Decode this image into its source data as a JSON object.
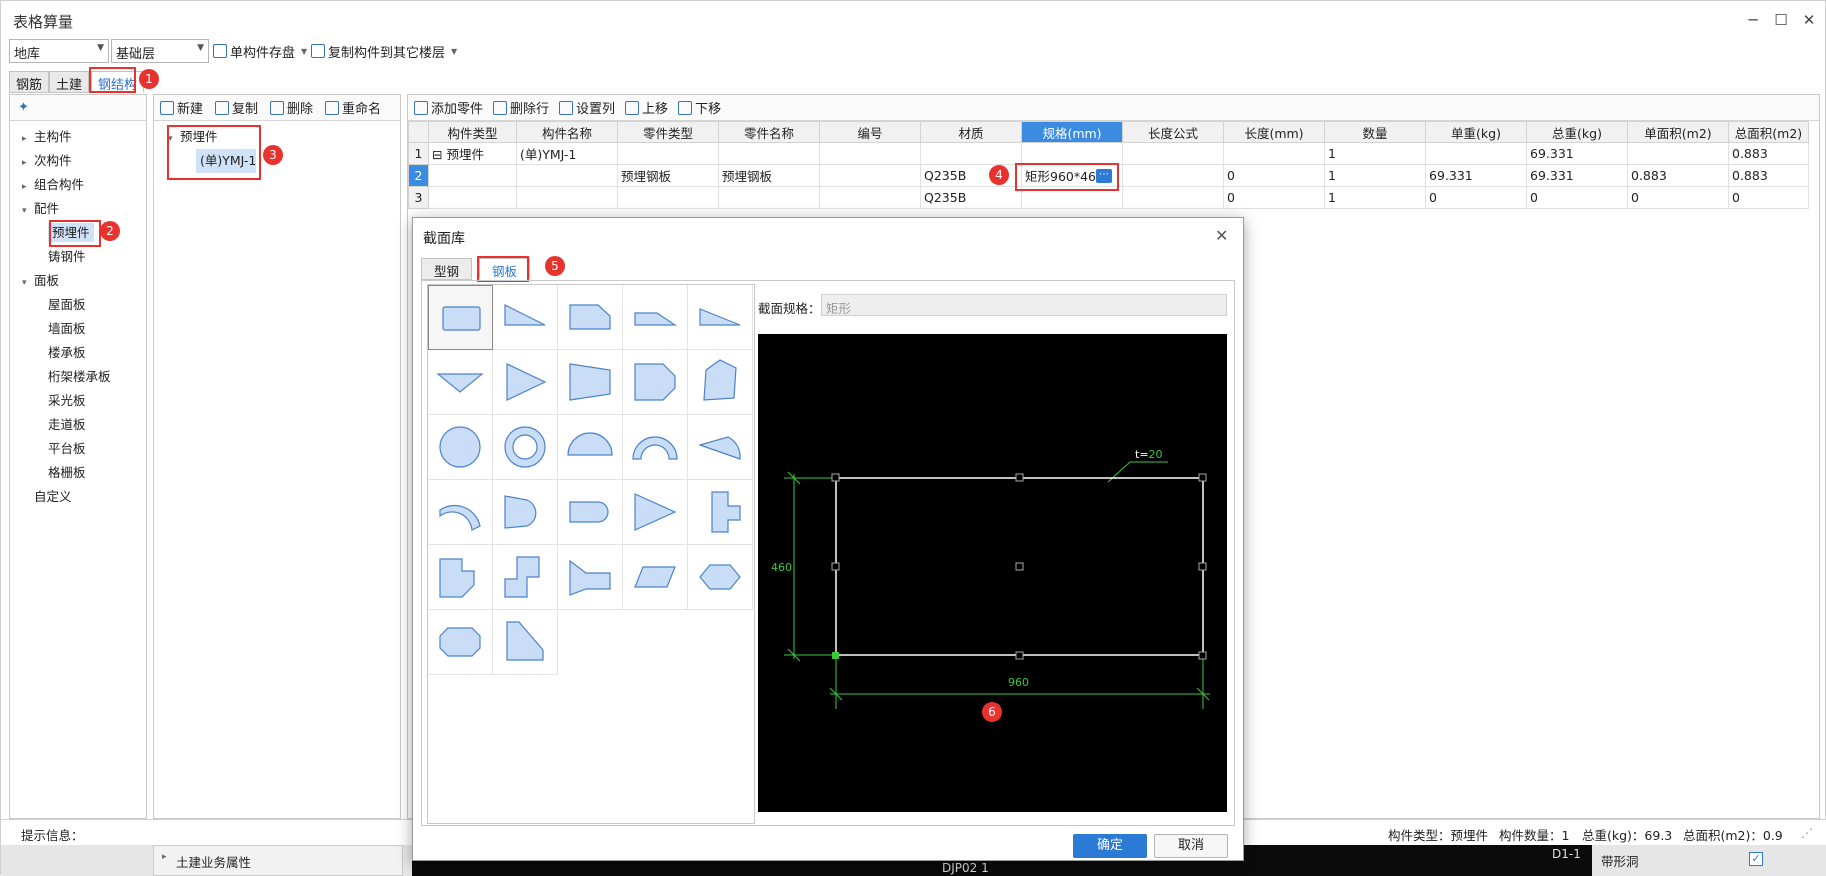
{
  "window": {
    "title": "表格算量"
  },
  "toolbar": {
    "floor_group": "地库",
    "floor": "基础层",
    "save_label": "单构件存盘",
    "copy_label": "复制构件到其它楼层"
  },
  "tabs": [
    "钢筋",
    "土建",
    "钢结构"
  ],
  "badges": [
    "1",
    "2",
    "3",
    "4",
    "5",
    "6"
  ],
  "left_tree": {
    "items": [
      {
        "label": "主构件",
        "caret": "▸",
        "indent": 0
      },
      {
        "label": "次构件",
        "caret": "▸",
        "indent": 0
      },
      {
        "label": "组合构件",
        "caret": "▸",
        "indent": 0
      },
      {
        "label": "配件",
        "caret": "▾",
        "indent": 0
      },
      {
        "label": "预埋件",
        "caret": "",
        "indent": 1
      },
      {
        "label": "铸钢件",
        "caret": "",
        "indent": 1
      },
      {
        "label": "面板",
        "caret": "▾",
        "indent": 0
      },
      {
        "label": "屋面板",
        "caret": "",
        "indent": 1
      },
      {
        "label": "墙面板",
        "caret": "",
        "indent": 1
      },
      {
        "label": "楼承板",
        "caret": "",
        "indent": 1
      },
      {
        "label": "桁架楼承板",
        "caret": "",
        "indent": 1
      },
      {
        "label": "采光板",
        "caret": "",
        "indent": 1
      },
      {
        "label": "走道板",
        "caret": "",
        "indent": 1
      },
      {
        "label": "平台板",
        "caret": "",
        "indent": 1
      },
      {
        "label": "格栅板",
        "caret": "",
        "indent": 1
      },
      {
        "label": "自定义",
        "caret": "",
        "indent": 0
      }
    ]
  },
  "mid_panel": {
    "new": "新建",
    "copy": "复制",
    "delete": "删除",
    "rename": "重命名",
    "parent": "预埋件",
    "child": "(单)YMJ-1"
  },
  "grid_toolbar": {
    "add_part": "添加零件",
    "delete_row": "删除行",
    "set_columns": "设置列",
    "move_up": "上移",
    "move_down": "下移"
  },
  "grid": {
    "headers": [
      "构件类型",
      "构件名称",
      "零件类型",
      "零件名称",
      "编号",
      "材质",
      "规格(mm)",
      "长度公式",
      "长度(mm)",
      "数量",
      "单重(kg)",
      "总重(kg)",
      "单面积(m2)",
      "总面积(m2)"
    ],
    "rows": [
      [
        "1",
        "⊟ 预埋件",
        "(单)YMJ-1",
        "",
        "",
        "",
        "",
        "",
        "",
        "",
        "1",
        "",
        "69.331",
        "",
        "0.883"
      ],
      [
        "2",
        "",
        "",
        "预埋钢板",
        "预埋钢板",
        "",
        "Q235B",
        "矩形960*460",
        "",
        "0",
        "1",
        "69.331",
        "69.331",
        "0.883",
        "0.883"
      ],
      [
        "3",
        "",
        "",
        "",
        "",
        "",
        "Q235B",
        "",
        "",
        "0",
        "1",
        "0",
        "0",
        "0",
        "0"
      ]
    ]
  },
  "status": {
    "hint": "提示信息：",
    "type": "构件类型：预埋件",
    "count": "构件数量：1",
    "weight": "总重(kg)：69.3",
    "area": "总面积(m2)：0.9"
  },
  "behind": {
    "prop": "土建业务属性",
    "cad": "DJP02 1",
    "d": "D1-1",
    "hole": "带形洞"
  },
  "dialog": {
    "title": "截面库",
    "tabs": [
      "型钢",
      "钢板"
    ],
    "spec_label": "截面规格：",
    "spec_value": "矩形",
    "ok": "确定",
    "cancel": "取消",
    "preview": {
      "thickness_prefix": "t=",
      "thickness": "20",
      "height": "460",
      "width": "960"
    }
  },
  "colors": {
    "accent": "#2b7ad6",
    "badge": "#e8322d",
    "shape_fill": "#c9ddf7",
    "shape_stroke": "#4b83c9",
    "cad_green": "#3cc83c"
  }
}
